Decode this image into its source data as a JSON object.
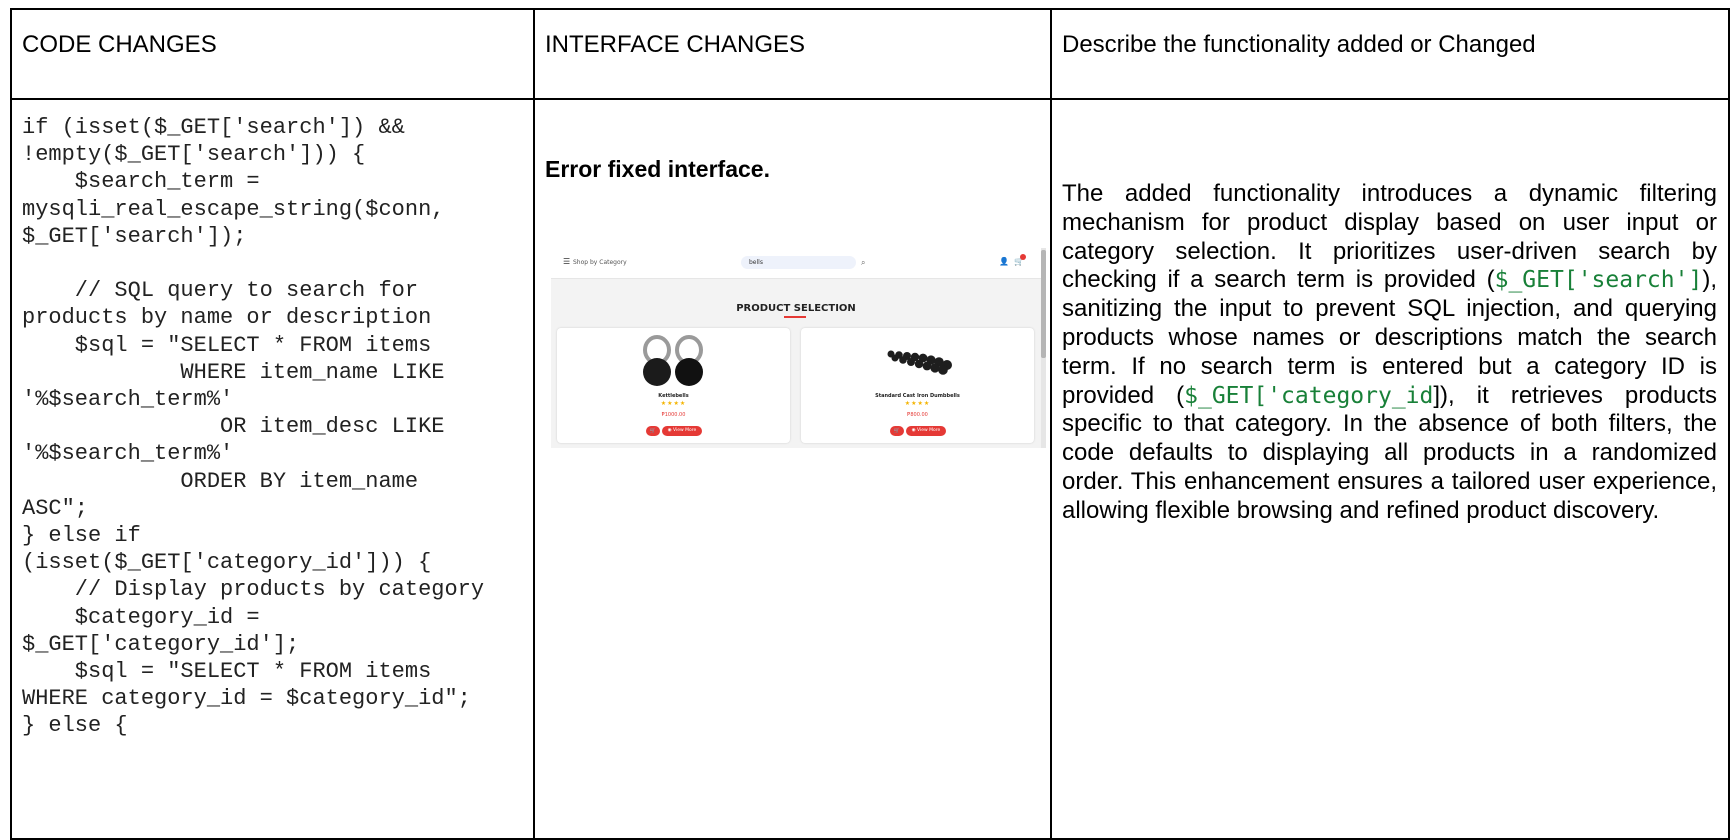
{
  "table": {
    "headers": {
      "code": "CODE CHANGES",
      "interface": "INTERFACE CHANGES",
      "description": "Describe the functionality added or Changed"
    },
    "code_lines": [
      "if (isset($_GET['search']) &&",
      "!empty($_GET['search'])) {",
      "    $search_term =",
      "mysqli_real_escape_string($conn,",
      "$_GET['search']);",
      "",
      "    // SQL query to search for",
      "products by name or description",
      "    $sql = \"SELECT * FROM items",
      "            WHERE item_name LIKE",
      "'%$search_term%'",
      "               OR item_desc LIKE",
      "'%$search_term%'",
      "            ORDER BY item_name",
      "ASC\";",
      "} else if",
      "(isset($_GET['category_id'])) {",
      "    // Display products by category",
      "    $category_id =",
      "$_GET['category_id'];",
      "    $sql = \"SELECT * FROM items",
      "WHERE category_id = $category_id\";",
      "} else {"
    ],
    "interface_title": "Error fixed interface.",
    "description": {
      "part1": "The added functionality introduces a dynamic filtering mechanism for product display based on user input or category selection. It prioritizes user-driven search by checking if a search term is provided (",
      "code1": "$_GET['search']",
      "part2": "), sanitizing the input to prevent SQL injection, and querying products whose names or descriptions match the search term. If no search term is entered but a category ID is provided (",
      "code2": "$_GET['category_id",
      "part3": "]), it retrieves products specific to that category. In the absence of both filters, the code defaults to displaying all products in a randomized order. This enhancement ensures a tailored user experience, allowing flexible browsing and refined product discovery."
    }
  },
  "screenshot": {
    "nav": {
      "category_label": "Shop by Category",
      "search_value": "bells"
    },
    "section_title": "PRODUCT SELECTION",
    "products": [
      {
        "name": "Kettlebells",
        "stars": "★★★★",
        "price": "₱1000.00",
        "view_label": "View More"
      },
      {
        "name": "Standard Cast Iron Dumbbells",
        "stars": "★★★★",
        "price": "₱800.00",
        "view_label": "View More"
      }
    ],
    "colors": {
      "accent": "#e53935",
      "star": "#f4b400",
      "search_bg": "#eef2fb"
    }
  }
}
